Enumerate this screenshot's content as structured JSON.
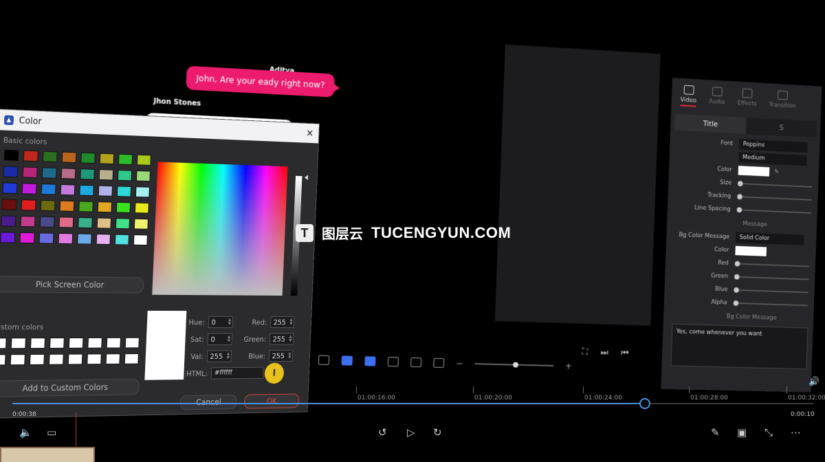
{
  "chat": {
    "sender1": "Aditya",
    "message1": "John, Are your eady right now?",
    "sender2": "Jhon Stones",
    "message2": "Yes, come whenever you want"
  },
  "inspector": {
    "tabs": [
      "Video",
      "Audio",
      "Effects",
      "Transition"
    ],
    "subtabs": [
      "Title",
      "S"
    ],
    "font_label": "Font",
    "font_value": "Poppins",
    "weight_value": "Medium",
    "color_label": "Color",
    "size_label": "Size",
    "tracking_label": "Tracking",
    "line_spacing_label": "Line Spacing",
    "message_section": "Message",
    "bg_color_message_label": "Bg Color Message",
    "bg_color_message_value": "Solid Color",
    "color2_label": "Color",
    "red_label": "Red",
    "green_label": "Green",
    "blue_label": "Blue",
    "alpha_label": "Alpha",
    "bg_section": "Bg Color Message",
    "text_value": "Yes, come whenever you want"
  },
  "dialog": {
    "title": "Color",
    "basic_colors_label": "Basic colors",
    "pick_screen_color": "Pick Screen Color",
    "custom_colors_label": "Custom colors",
    "add_custom_colors": "Add to Custom Colors",
    "hue_label": "Hue:",
    "hue_value": "0",
    "sat_label": "Sat:",
    "sat_value": "0",
    "val_label": "Val:",
    "val_value": "255",
    "red_label": "Red:",
    "red_value": "255",
    "green_label": "Green:",
    "green_value": "255",
    "blue_label": "Blue:",
    "blue_value": "255",
    "html_label": "HTML:",
    "html_value": "#ffffff",
    "cancel_label": "Cancel",
    "ok_label": "OK",
    "basic_colors": [
      "#000000",
      "#c0281e",
      "#2a6e1e",
      "#b8631a",
      "#1f8a2a",
      "#b4a21a",
      "#2fba2a",
      "#a8c81a",
      "#1a2aa8",
      "#b8237a",
      "#1e6a8a",
      "#b86a8a",
      "#1e9a7a",
      "#b8b08a",
      "#2ec88a",
      "#9ad87a",
      "#1e3ad8",
      "#c01ae0",
      "#1e7ad8",
      "#c07ae0",
      "#1ea8e0",
      "#b0b0e8",
      "#2ed8d8",
      "#a8f0f0",
      "#6a0e0e",
      "#e01e1e",
      "#6a6a0e",
      "#e07a1e",
      "#4aa81e",
      "#e0a81e",
      "#3ae01e",
      "#e8e81e",
      "#4a1a8a",
      "#c03a8a",
      "#4a4a8a",
      "#e06a8a",
      "#3ab08a",
      "#e0c08a",
      "#40e08a",
      "#f0f070",
      "#6a1ad8",
      "#e01ad8",
      "#6a6ae0",
      "#e07ae0",
      "#6aa8e8",
      "#e8b0f0",
      "#50e0e0",
      "#ffffff"
    ],
    "custom_colors": [
      "#ffffff",
      "#ffffff",
      "#ffffff",
      "#ffffff",
      "#ffffff",
      "#ffffff",
      "#ffffff",
      "#ffffff",
      "#ffffff",
      "#ffffff",
      "#ffffff",
      "#ffffff",
      "#ffffff",
      "#ffffff",
      "#ffffff",
      "#ffffff"
    ]
  },
  "watermark": {
    "logo": "T",
    "cn": "图层云",
    "en": "TUCENGYUN.COM"
  },
  "timeline": {
    "ticks": [
      "01:00:16:00",
      "01:00:20:00",
      "01:00:24:00",
      "01:00:28:00",
      "01:00:32:00"
    ]
  },
  "player": {
    "current_time": "0:00:38",
    "remaining_time": "0:00:10",
    "progress_fraction": 0.79,
    "accent": "#4a8fe0"
  }
}
